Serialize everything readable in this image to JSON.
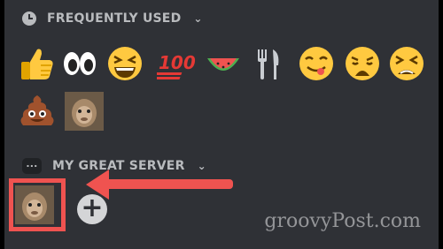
{
  "sections": {
    "frequently_used": {
      "label": "FREQUENTLY USED",
      "icon": "clock-icon"
    },
    "server": {
      "label": "MY GREAT SERVER",
      "icon_text": "..."
    }
  },
  "emojis": [
    {
      "name": "thumbs-up"
    },
    {
      "name": "eyes"
    },
    {
      "name": "grinning-squinting-face"
    },
    {
      "name": "hundred-points"
    },
    {
      "name": "watermelon"
    },
    {
      "name": "fork-and-knife"
    },
    {
      "name": "face-savoring-food"
    },
    {
      "name": "weary-face"
    },
    {
      "name": "tired-face"
    },
    {
      "name": "pile-of-poo"
    },
    {
      "name": "monkey-custom-emoji"
    }
  ],
  "server_emojis": [
    {
      "name": "monkey-custom-emoji"
    }
  ],
  "add_button_label": "+",
  "watermark": "groovyPost.com",
  "colors": {
    "panel_bg": "#2f3136",
    "header_text": "#b9bbbe",
    "highlight": "#ef5350"
  }
}
